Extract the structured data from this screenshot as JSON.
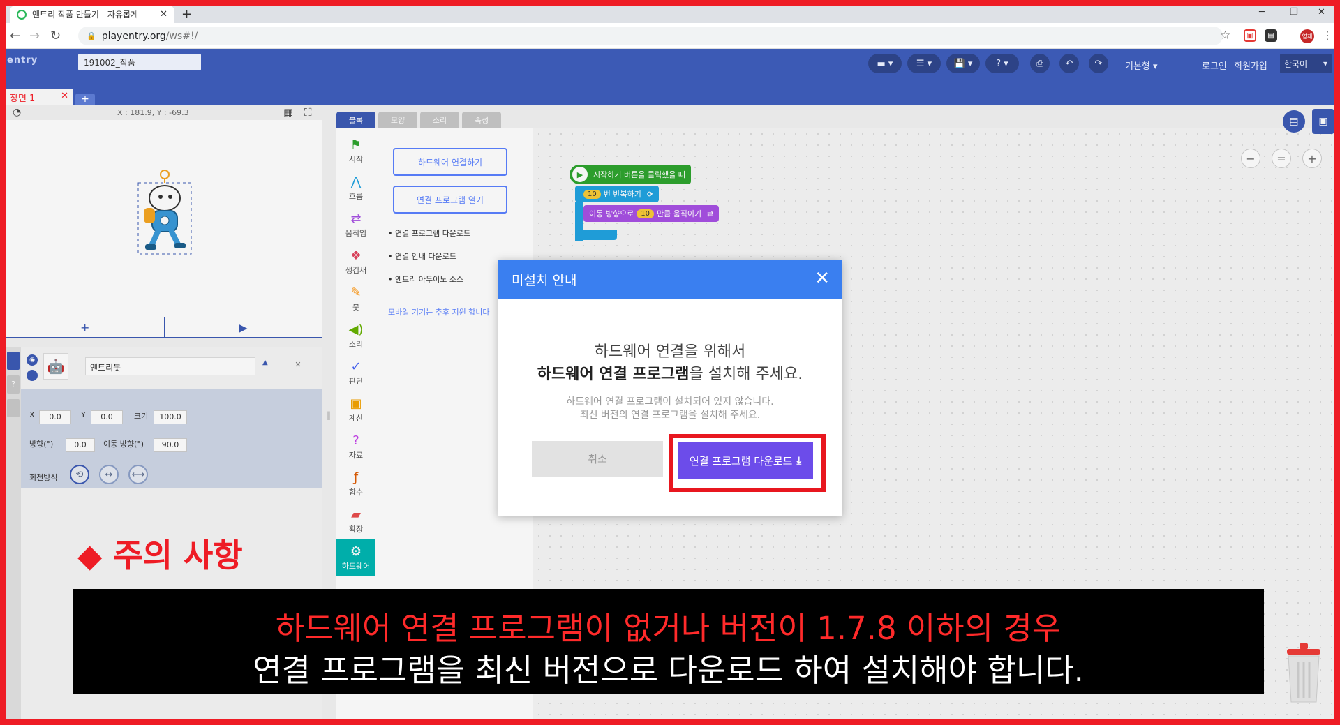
{
  "browser": {
    "tab_title": "엔트리 작품 만들기 - 자유롭게",
    "url_host": "playentry.org",
    "url_path": "/ws#!/",
    "profile_badge": "영재"
  },
  "header": {
    "logo": "entry",
    "project_name": "191002_작품",
    "mode": "기본형",
    "login": "로그인",
    "signup": "회원가입",
    "language": "한국어"
  },
  "scene": {
    "tab_label": "장면 1"
  },
  "stage": {
    "coords": "X : 181.9, Y : -69.3"
  },
  "object": {
    "name": "엔트리봇",
    "x_label": "X",
    "x": "0.0",
    "y_label": "Y",
    "y": "0.0",
    "size_label": "크기",
    "size": "100.0",
    "direction_label": "방향(°)",
    "direction": "0.0",
    "move_dir_label": "이동 방향(°)",
    "move_dir": "90.0",
    "rotation_label": "회전방식"
  },
  "palette": {
    "tabs": [
      "블록",
      "모양",
      "소리",
      "속성"
    ],
    "categories": [
      "시작",
      "흐름",
      "움직임",
      "생김새",
      "붓",
      "소리",
      "판단",
      "계산",
      "자료",
      "함수",
      "확장",
      "하드웨어"
    ],
    "hw_connect": "하드웨어 연결하기",
    "hw_open": "연결 프로그램 열기",
    "links": [
      "• 연결 프로그램 다운로드",
      "• 연결 안내 다운로드",
      "• 엔트리 아두이노 소스"
    ],
    "mobile_note": "모바일 기기는 추후 지원 합니다"
  },
  "blocks": {
    "start": "시작하기 버튼을 클릭했을 때",
    "repeat_count": "10",
    "repeat_label": "번 반복하기",
    "move_label": "이동 방향으로",
    "move_count": "10",
    "move_suffix": "만큼 움직이기"
  },
  "modal": {
    "title": "미설치 안내",
    "line1": "하드웨어 연결을 위해서",
    "line2_bold": "하드웨어 연결 프로그램",
    "line2_rest": "을 설치해 주세요.",
    "sub1": "하드웨어 연결 프로그램이 설치되어 있지 않습니다.",
    "sub2": "최신 버전의 연결 프로그램을 설치해 주세요.",
    "cancel": "취소",
    "download": "연결 프로그램 다운로드"
  },
  "annotation": {
    "warning": "◆ 주의 사항",
    "caption1": "하드웨어 연결 프로그램이 없거나 버전이 1.7.8 이하의 경우",
    "caption2": "연결 프로그램을 최신 버전으로 다운로드 하여 설치해야 합니다."
  },
  "colors": {
    "frame_red": "#ee1c25",
    "entry_blue": "#3c5ab5",
    "modal_header": "#3a7ff0",
    "download_button": "#6c4cea",
    "start_block": "#2ea42e",
    "flow_block": "#21a3e0",
    "move_block": "#a751e3"
  }
}
